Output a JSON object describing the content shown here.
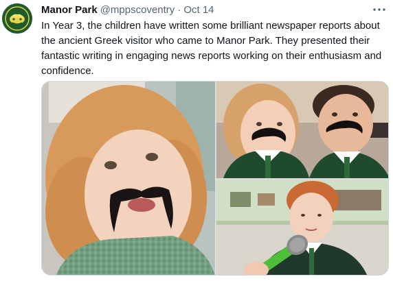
{
  "tweet": {
    "author_name": "Manor Park",
    "handle": "@mppscoventry",
    "separator": "·",
    "date": "Oct 14",
    "text": "In Year 3, the children have written some brilliant newspaper reports about the ancient Greek visitor who came to Manor Park. They presented their fantastic writing in engaging news reports working on their enthusiasm and confidence."
  },
  "icons": {
    "more": "more-horizontal-icon",
    "avatar": "school-logo"
  },
  "colors": {
    "name": "#0f1419",
    "secondary": "#536471",
    "border": "#cfd9de",
    "avatar_bg": "#1f5a2a"
  },
  "media": {
    "photo_count": 3
  }
}
